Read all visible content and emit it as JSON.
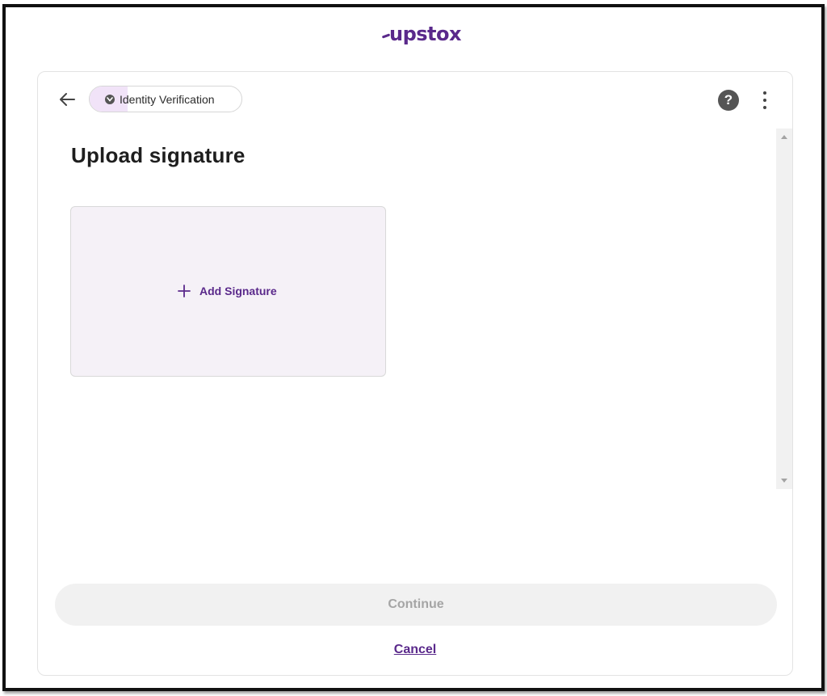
{
  "brand": {
    "logo_text": "upstox",
    "color": "#5a298b"
  },
  "header": {
    "back_icon": "arrow-left-icon",
    "step_label": "Identity Verification",
    "step_icon": "chevron-down-circle-icon",
    "step_progress_fraction": 0.25,
    "help_icon": "question-circle-icon",
    "more_icon": "vertical-dots-icon"
  },
  "main": {
    "title": "Upload signature",
    "upload": {
      "icon": "plus-icon",
      "label": "Add Signature"
    }
  },
  "footer": {
    "continue_label": "Continue",
    "cancel_label": "Cancel"
  }
}
